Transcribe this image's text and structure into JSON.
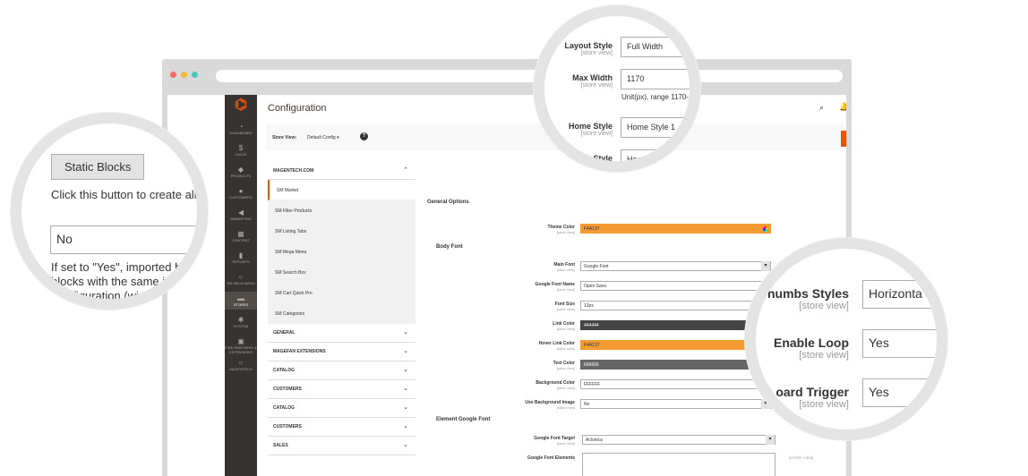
{
  "browser": {
    "dots": [
      "#f26b5b",
      "#f5b83b",
      "#49c6b6"
    ]
  },
  "sidebar": {
    "items": [
      {
        "label": "DASHBOARD",
        "icon": "dashboard-icon",
        "glyph": "◔"
      },
      {
        "label": "SALES",
        "icon": "dollar-icon",
        "glyph": "$"
      },
      {
        "label": "PRODUCTS",
        "icon": "cube-icon",
        "glyph": "◆"
      },
      {
        "label": "CUSTOMERS",
        "icon": "person-icon",
        "glyph": "●"
      },
      {
        "label": "MARKETING",
        "icon": "megaphone-icon",
        "glyph": "◀"
      },
      {
        "label": "CONTENT",
        "icon": "layout-icon",
        "glyph": "▦"
      },
      {
        "label": "REPORTS",
        "icon": "bar-chart-icon",
        "glyph": "▮"
      },
      {
        "label": "SM MEGA MENU",
        "icon": "circle-icon",
        "glyph": "○"
      },
      {
        "label": "STORES",
        "icon": "store-icon",
        "glyph": "▬"
      },
      {
        "label": "SYSTEM",
        "icon": "gear-icon",
        "glyph": "✱"
      },
      {
        "label": "FIND PARTNERS & EXTENSIONS",
        "icon": "puzzle-icon",
        "glyph": "▣"
      },
      {
        "label": "MAGENTECH",
        "icon": "circle-icon",
        "glyph": "○"
      }
    ],
    "active": "STORES"
  },
  "header": {
    "title": "Configuration",
    "search_glyph": "⌕",
    "bell_glyph": "🔔"
  },
  "scope": {
    "label": "Store View:",
    "value": "Default Config ▾",
    "help": "?"
  },
  "tabs": {
    "group_top": "MAGENTECH.COM",
    "items": [
      "SM Market",
      "SM Filter Products",
      "SM Listing Tabs",
      "SM Mega Menu",
      "SM Search Box",
      "SM Cart Quick Pro",
      "SM Categories"
    ],
    "groups": [
      "GENERAL",
      "MAGEFAN EXTENSIONS",
      "CATALOG",
      "CUSTOMERS",
      "CATALOG",
      "CUSTOMERS",
      "SALES"
    ]
  },
  "form": {
    "general_options": "General Options",
    "theme_color_label": "Theme Color",
    "theme_color": "F4A137",
    "body_font": "Body Font",
    "main_font_label": "Main Font",
    "main_font": "Google Font",
    "google_font_name_label": "Google Font Name",
    "google_font_name": "Open Sans",
    "font_size_label": "Font Size",
    "font_size": "12px",
    "link_color_label": "Link Color",
    "link_color": "444444",
    "hover_link_color_label": "Hover Link Color",
    "hover_link_color": "F4A137",
    "text_color_label": "Text Color",
    "text_color": "666666",
    "background_color_label": "Background Color",
    "background_color": "FFFFFF",
    "use_bg_image_label": "Use Background Image",
    "use_bg_image": "No",
    "element_google_font": "Element Google Font",
    "google_font_target_label": "Google Font Target",
    "google_font_target": "Aclonica",
    "google_font_elements_label": "Google Font Elements",
    "store_view": "[store view]",
    "store_view_upper": "[STORE VIEW]"
  },
  "zoom_left": {
    "button": "Static Blocks",
    "hint": "Click this button to create all",
    "label_fragment": "ks",
    "select_value": "No",
    "note_line1": "If set to \"Yes\", imported b",
    "note_line2": "blocks with the same i",
    "note_line3": "nfiguration (wi"
  },
  "zoom_top": {
    "layout_style_label": "Layout Style",
    "layout_style": "Full Width",
    "max_width_label": "Max Width",
    "max_width": "1170",
    "max_width_note": "Unit(px), range 1170-1",
    "home_style_label": "Home Style",
    "home_style": "Home Style 1",
    "header_style_label": "r Style",
    "header_style": "Heade",
    "store_view": "[store view]"
  },
  "zoom_right": {
    "thumbs_label": "humbs Styles",
    "thumbs_value": "Horizonta",
    "loop_label": "Enable Loop",
    "loop_value": "Yes",
    "keyboard_label": "oard Trigger",
    "keyboard_value": "Yes",
    "store_view": "[store view]"
  }
}
